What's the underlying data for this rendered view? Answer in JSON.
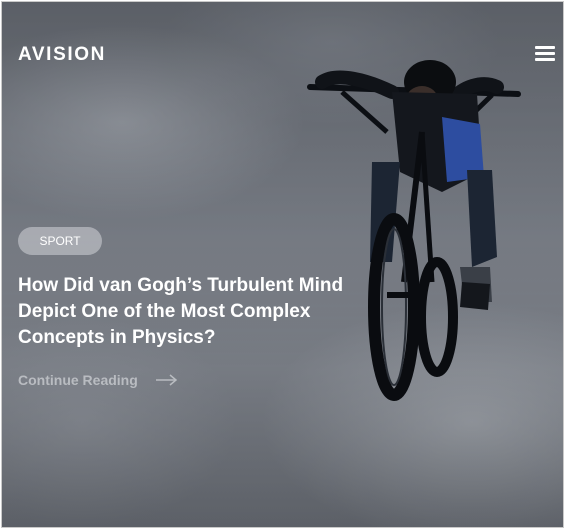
{
  "brand": {
    "name": "AVISION"
  },
  "nav": {
    "menu_icon": "hamburger-menu-icon"
  },
  "hero": {
    "image_icon": "bmx-rider-photo",
    "category": "SPORT",
    "title": "How Did van Gogh’s Turbulent Mind Depict One of the Most Complex Concepts in Physics?",
    "cta_label": "Continue Reading",
    "cta_icon": "arrow-right-icon"
  },
  "colors": {
    "text": "#ffffff",
    "cta": "#b9bcc1",
    "badge_bg": "#c9cbcf"
  }
}
